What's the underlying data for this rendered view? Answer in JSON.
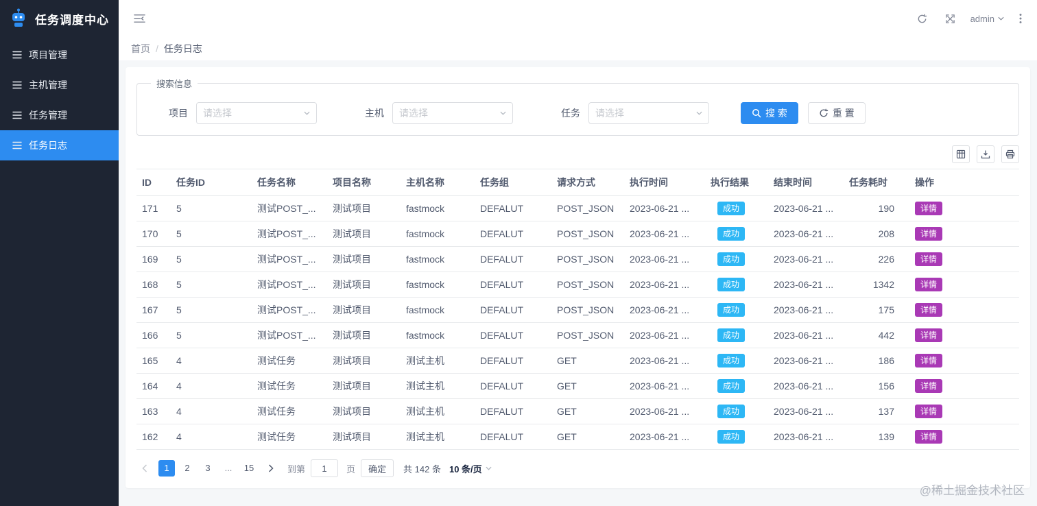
{
  "colors": {
    "accent": "#2d8cf0",
    "sidebar_bg": "#1e2533",
    "success_badge": "#2db7f5",
    "detail_badge": "#a939b5",
    "content_bg": "#f5f7f9"
  },
  "app": {
    "title": "任务调度中心",
    "watermark": "@稀土掘金技术社区"
  },
  "sidebar": {
    "items": [
      {
        "name": "project-management",
        "label": "项目管理",
        "active": false
      },
      {
        "name": "host-management",
        "label": "主机管理",
        "active": false
      },
      {
        "name": "task-management",
        "label": "任务管理",
        "active": false
      },
      {
        "name": "task-log",
        "label": "任务日志",
        "active": true
      }
    ]
  },
  "header": {
    "user": "admin"
  },
  "breadcrumb": {
    "home": "首页",
    "divider": "/",
    "current": "任务日志"
  },
  "search": {
    "legend": "搜索信息",
    "fields": [
      {
        "label": "项目",
        "placeholder": "请选择"
      },
      {
        "label": "主机",
        "placeholder": "请选择"
      },
      {
        "label": "任务",
        "placeholder": "请选择"
      }
    ],
    "search_label": "搜 索",
    "reset_label": "重 置"
  },
  "table": {
    "headers": [
      "ID",
      "任务ID",
      "任务名称",
      "项目名称",
      "主机名称",
      "任务组",
      "请求方式",
      "执行时间",
      "执行结果",
      "结束时间",
      "任务耗时",
      "操作"
    ],
    "rows": [
      {
        "id": "171",
        "task_id": "5",
        "task_name": "测试POST_...",
        "project": "测试项目",
        "host": "fastmock",
        "group": "DEFALUT",
        "method": "POST_JSON",
        "exec_time": "2023-06-21 ...",
        "result": "成功",
        "end_time": "2023-06-21 ...",
        "duration": "190",
        "action": "详情"
      },
      {
        "id": "170",
        "task_id": "5",
        "task_name": "测试POST_...",
        "project": "测试项目",
        "host": "fastmock",
        "group": "DEFALUT",
        "method": "POST_JSON",
        "exec_time": "2023-06-21 ...",
        "result": "成功",
        "end_time": "2023-06-21 ...",
        "duration": "208",
        "action": "详情"
      },
      {
        "id": "169",
        "task_id": "5",
        "task_name": "测试POST_...",
        "project": "测试项目",
        "host": "fastmock",
        "group": "DEFALUT",
        "method": "POST_JSON",
        "exec_time": "2023-06-21 ...",
        "result": "成功",
        "end_time": "2023-06-21 ...",
        "duration": "226",
        "action": "详情"
      },
      {
        "id": "168",
        "task_id": "5",
        "task_name": "测试POST_...",
        "project": "测试项目",
        "host": "fastmock",
        "group": "DEFALUT",
        "method": "POST_JSON",
        "exec_time": "2023-06-21 ...",
        "result": "成功",
        "end_time": "2023-06-21 ...",
        "duration": "1342",
        "action": "详情"
      },
      {
        "id": "167",
        "task_id": "5",
        "task_name": "测试POST_...",
        "project": "测试项目",
        "host": "fastmock",
        "group": "DEFALUT",
        "method": "POST_JSON",
        "exec_time": "2023-06-21 ...",
        "result": "成功",
        "end_time": "2023-06-21 ...",
        "duration": "175",
        "action": "详情"
      },
      {
        "id": "166",
        "task_id": "5",
        "task_name": "测试POST_...",
        "project": "测试项目",
        "host": "fastmock",
        "group": "DEFALUT",
        "method": "POST_JSON",
        "exec_time": "2023-06-21 ...",
        "result": "成功",
        "end_time": "2023-06-21 ...",
        "duration": "442",
        "action": "详情"
      },
      {
        "id": "165",
        "task_id": "4",
        "task_name": "测试任务",
        "project": "测试项目",
        "host": "测试主机",
        "group": "DEFALUT",
        "method": "GET",
        "exec_time": "2023-06-21 ...",
        "result": "成功",
        "end_time": "2023-06-21 ...",
        "duration": "186",
        "action": "详情"
      },
      {
        "id": "164",
        "task_id": "4",
        "task_name": "测试任务",
        "project": "测试项目",
        "host": "测试主机",
        "group": "DEFALUT",
        "method": "GET",
        "exec_time": "2023-06-21 ...",
        "result": "成功",
        "end_time": "2023-06-21 ...",
        "duration": "156",
        "action": "详情"
      },
      {
        "id": "163",
        "task_id": "4",
        "task_name": "测试任务",
        "project": "测试项目",
        "host": "测试主机",
        "group": "DEFALUT",
        "method": "GET",
        "exec_time": "2023-06-21 ...",
        "result": "成功",
        "end_time": "2023-06-21 ...",
        "duration": "137",
        "action": "详情"
      },
      {
        "id": "162",
        "task_id": "4",
        "task_name": "测试任务",
        "project": "测试项目",
        "host": "测试主机",
        "group": "DEFALUT",
        "method": "GET",
        "exec_time": "2023-06-21 ...",
        "result": "成功",
        "end_time": "2023-06-21 ...",
        "duration": "139",
        "action": "详情"
      }
    ]
  },
  "pagination": {
    "prev_disabled": true,
    "pages": [
      "1",
      "2",
      "3",
      "...",
      "15"
    ],
    "active_page": "1",
    "goto_label": "到第",
    "goto_value": "1",
    "page_unit": "页",
    "confirm_label": "确定",
    "total_label": "共 142 条",
    "page_size_label": "10 条/页"
  }
}
